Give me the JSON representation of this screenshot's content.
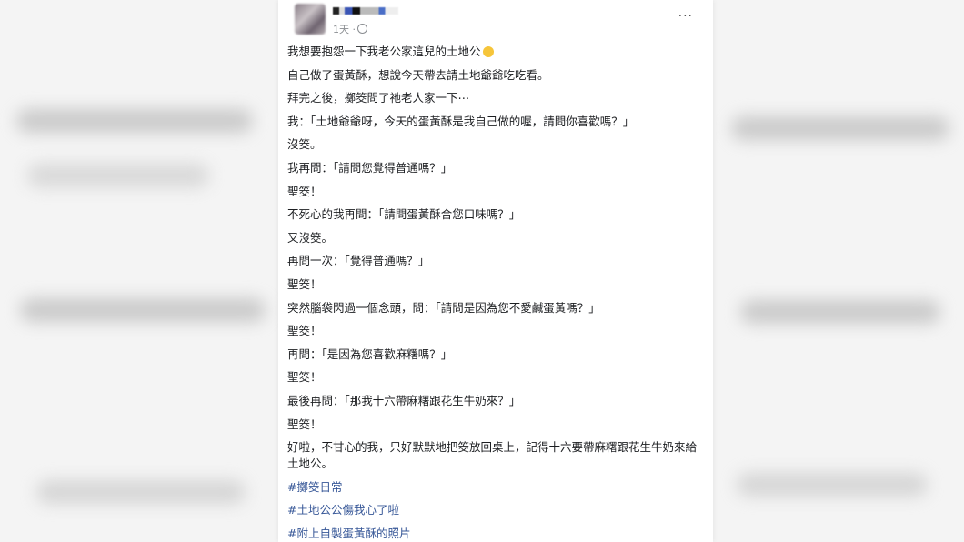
{
  "post": {
    "time": "1天",
    "more_label": "···",
    "emoji": "emoji-icon",
    "lines": [
      "我想要抱怨一下我老公家這兒的土地公",
      "自己做了蛋黃酥，想說今天帶去請土地爺爺吃吃看。",
      "拜完之後，擲筊問了祂老人家一下⋯",
      "我：「土地爺爺呀，今天的蛋黃酥是我自己做的喔，請問你喜歡嗎？」",
      "沒筊。",
      "我再問：「請問您覺得普通嗎？」",
      "聖筊！",
      "不死心的我再問：「請問蛋黃酥合您口味嗎？」",
      "又沒筊。",
      "再問一次：「覺得普通嗎？」",
      "聖筊！",
      "突然腦袋閃過一個念頭，問：「請問是因為您不愛鹹蛋黃嗎？」",
      "聖筊！",
      "再問：「是因為您喜歡麻糬嗎？」",
      "聖筊！",
      "最後再問：「那我十六帶麻糬跟花生牛奶來？」",
      "聖筊！",
      "好啦，不甘心的我，只好默默地把筊放回桌上，記得十六要帶麻糬跟花生牛奶來給土地公。"
    ],
    "hashtags": [
      "#擲筊日常",
      "#土地公公傷我心了啦",
      "#附上自製蛋黃酥的照片"
    ]
  }
}
